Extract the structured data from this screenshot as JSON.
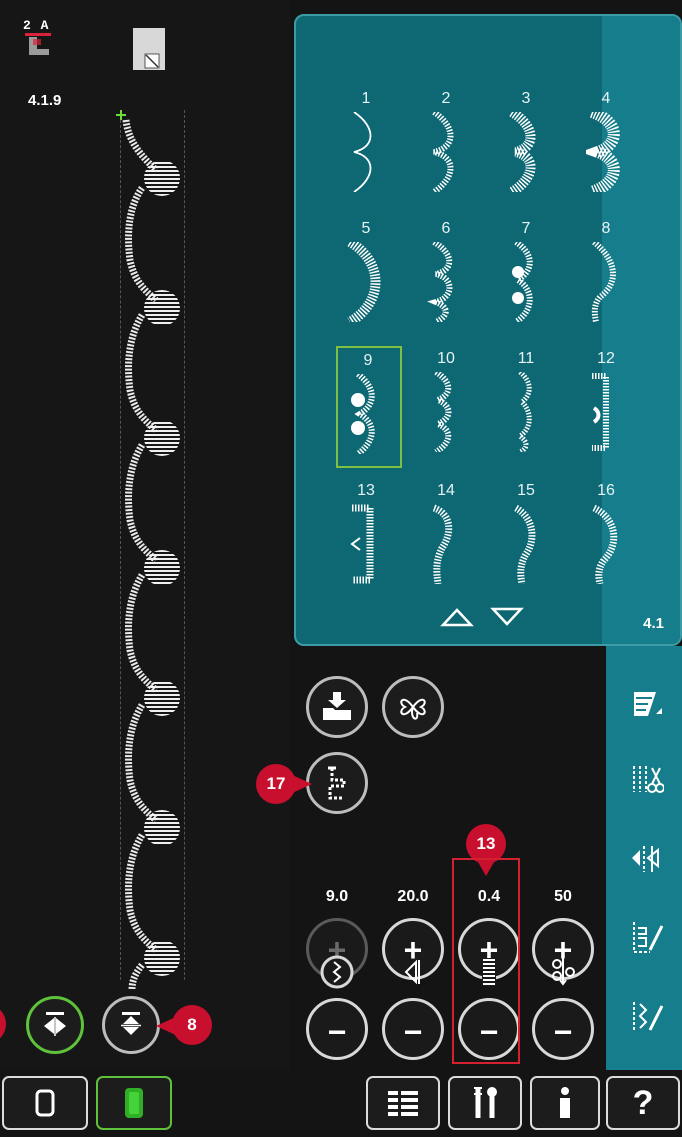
{
  "preview": {
    "foot_label": "2 A",
    "stitch_code": "4.1.9",
    "mirror_side_callout": "",
    "mirror_end_callout": "8"
  },
  "stitch_menu": {
    "stitches": [
      "1",
      "2",
      "3",
      "4",
      "5",
      "6",
      "7",
      "8",
      "9",
      "10",
      "11",
      "12",
      "13",
      "14",
      "15",
      "16"
    ],
    "selected": "9",
    "page_label": "4.1"
  },
  "tools": {
    "callout_17": "17",
    "callout_13": "13"
  },
  "params": [
    {
      "value": "9.0",
      "icon": "stitch-width-icon",
      "enabled": false
    },
    {
      "value": "20.0",
      "icon": "stitch-positioning-icon",
      "enabled": true
    },
    {
      "value": "0.4",
      "icon": "stitch-density-icon",
      "enabled": true
    },
    {
      "value": "50",
      "icon": "balance-icon",
      "enabled": true
    }
  ],
  "colors": {
    "panel": "#0d6873",
    "sidebar": "#157d8b",
    "callout": "#c8102e",
    "active": "#5ec23a",
    "highlight": "#d4202f"
  }
}
